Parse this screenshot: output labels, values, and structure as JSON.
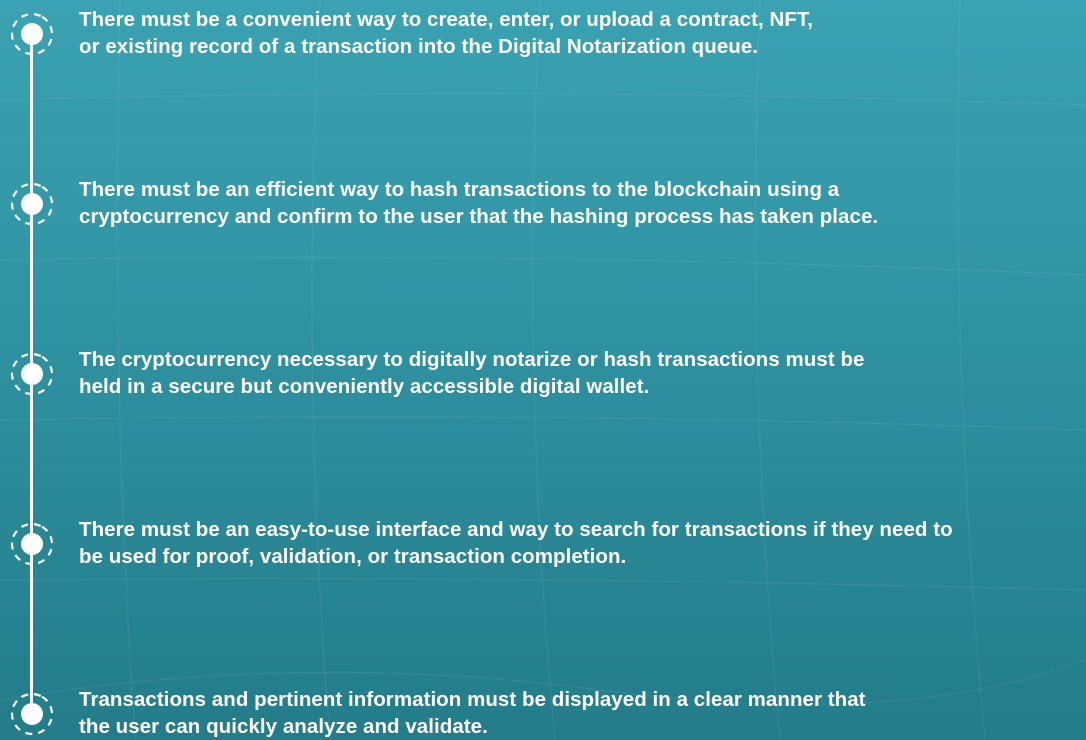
{
  "colors": {
    "background_top": "#3aa2b2",
    "background_bottom": "#237c89",
    "text": "#ffffff",
    "timeline": "#ffffff"
  },
  "timeline": {
    "marker_icon": "circle-dot-icon",
    "items": [
      {
        "text": "There must be a convenient way to create, enter, or upload a contract, NFT,\nor existing record of a transaction into the Digital Notarization queue."
      },
      {
        "text": "There must be an efficient way to hash transactions to the blockchain using a\ncryptocurrency and confirm to the user that the hashing process has taken place."
      },
      {
        "text": "The cryptocurrency necessary to digitally notarize or hash transactions must be\nheld in a secure but conveniently accessible digital wallet."
      },
      {
        "text": "There must be an easy-to-use interface and way to search for transactions if they need to\nbe used for proof, validation, or transaction completion."
      },
      {
        "text": "Transactions and pertinent information must be displayed in a clear manner that\nthe user can quickly analyze and validate."
      }
    ]
  }
}
